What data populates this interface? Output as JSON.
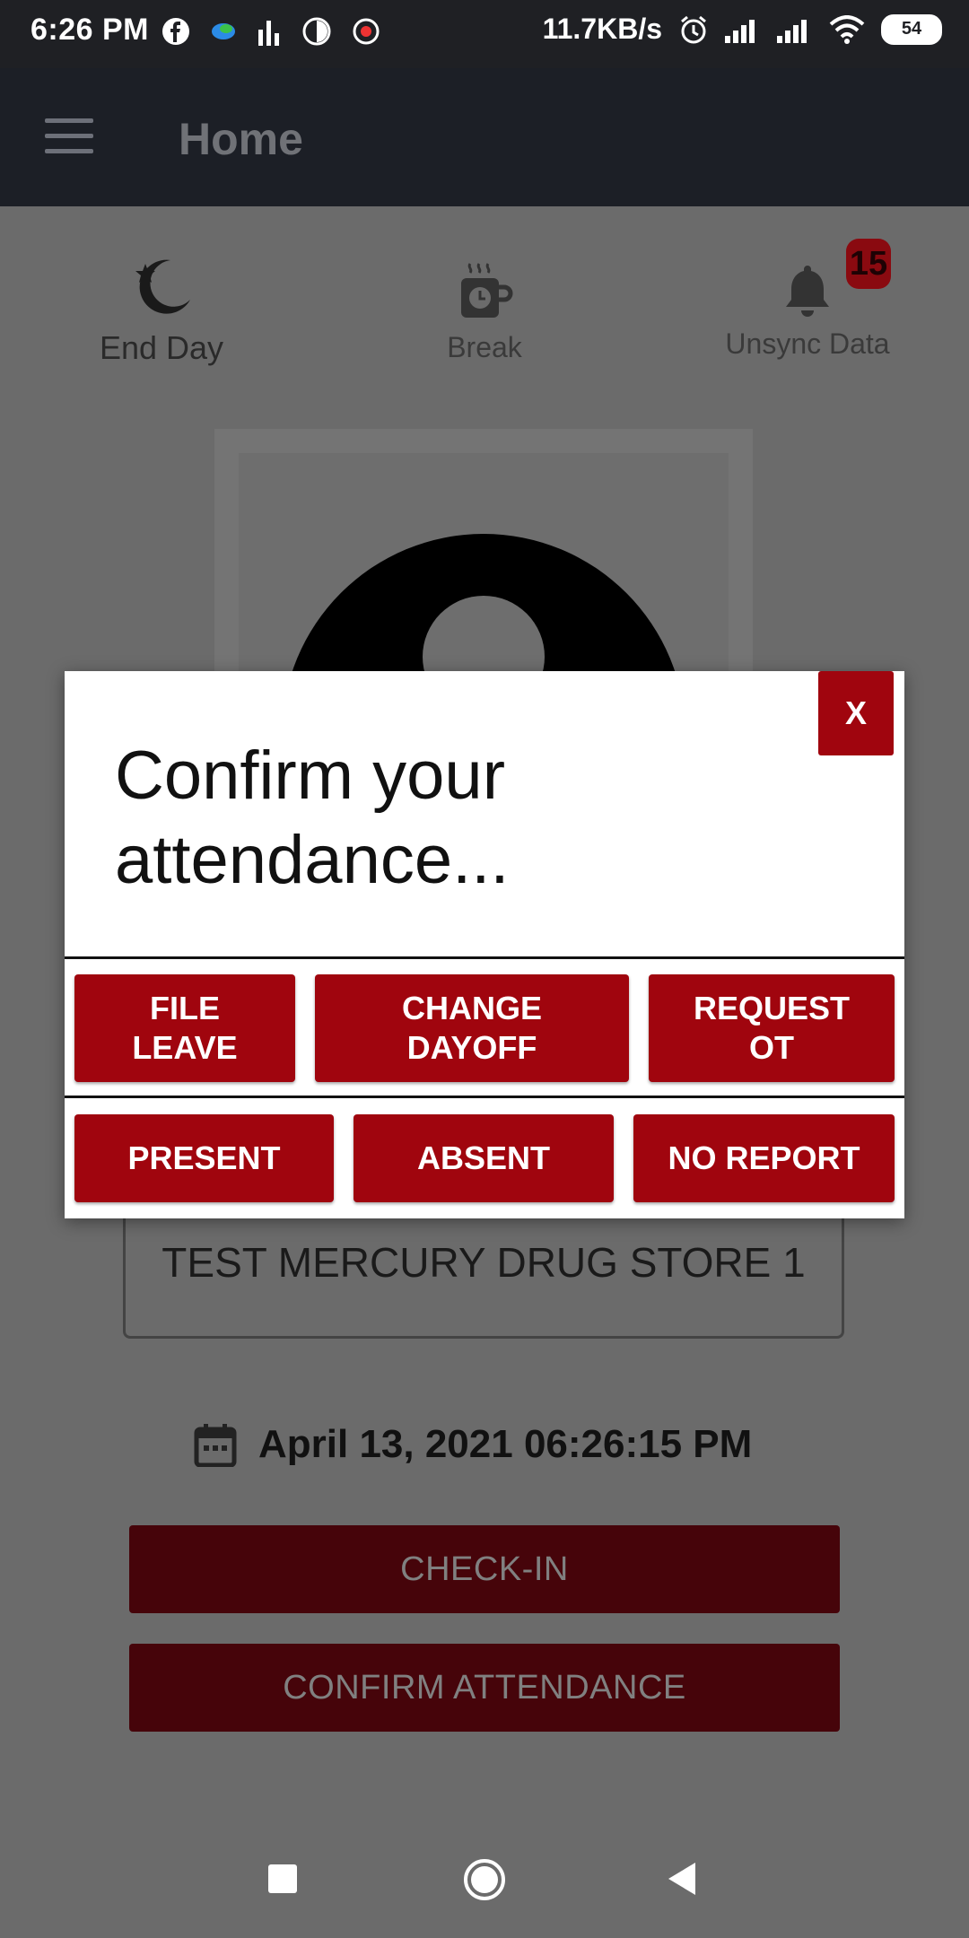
{
  "status_bar": {
    "time": "6:26 PM",
    "net_speed": "11.7KB/s",
    "battery": "54",
    "left_icons": [
      "facebook-icon",
      "app-icon",
      "stats-icon",
      "timer-icon",
      "record-icon"
    ],
    "right_icons": [
      "alarm-icon",
      "signal-icon",
      "signal-icon",
      "wifi-icon",
      "battery-icon"
    ]
  },
  "toolbar": {
    "title": "Home"
  },
  "actions": {
    "end_day": "End Day",
    "break": "Break",
    "unsync": "Unsync Data",
    "unsync_count": "15"
  },
  "store": "TEST MERCURY DRUG STORE 1",
  "datetime": "April 13, 2021 06:26:15 PM",
  "buttons": {
    "checkin": "CHECK-IN",
    "confirm_attendance": "CONFIRM ATTENDANCE"
  },
  "dialog": {
    "title": "Confirm your attendance...",
    "close": "X",
    "row1": [
      "FILE\nLEAVE",
      "CHANGE\nDAYOFF",
      "REQUEST\nOT"
    ],
    "row2": [
      "PRESENT",
      "ABSENT",
      "NO REPORT"
    ]
  },
  "colors": {
    "accent": "#a0050e",
    "toolbar": "#1c1f26",
    "dim": "#6b6b6b"
  }
}
